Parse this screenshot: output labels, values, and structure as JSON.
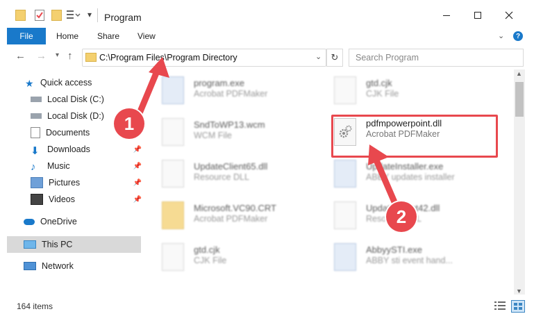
{
  "window": {
    "title": "Program"
  },
  "ribbon": {
    "tabs": [
      "File",
      "Home",
      "Share",
      "View"
    ]
  },
  "address": {
    "path": "C:\\Program Files\\Program Directory",
    "search_placeholder": "Search Program"
  },
  "nav": {
    "items": [
      {
        "label": "Quick access"
      },
      {
        "label": "Local Disk (C:)"
      },
      {
        "label": "Local Disk (D:)"
      },
      {
        "label": "Documents"
      },
      {
        "label": "Downloads"
      },
      {
        "label": "Music"
      },
      {
        "label": "Pictures"
      },
      {
        "label": "Videos"
      },
      {
        "label": "OneDrive"
      },
      {
        "label": "This PC"
      },
      {
        "label": "Network"
      }
    ]
  },
  "files": [
    {
      "name": "program.exe",
      "type": "Acrobat PDFMaker"
    },
    {
      "name": "gtd.cjk",
      "type": "CJK File"
    },
    {
      "name": "SndToWP13.wcm",
      "type": "WCM File"
    },
    {
      "name": "pdfmpowerpoint.dll",
      "type": "Acrobat PDFMaker"
    },
    {
      "name": "UpdateClient65.dll",
      "type": "Resource DLL"
    },
    {
      "name": "UpdateInstaller.exe",
      "type": "ABBY updates installer"
    },
    {
      "name": "Microsoft.VC90.CRT",
      "type": "Acrobat PDFMaker"
    },
    {
      "name": "UpdateClient42.dll",
      "type": "Resource DLL"
    },
    {
      "name": "gtd.cjk",
      "type": "CJK File"
    },
    {
      "name": "AbbyySTI.exe",
      "type": "ABBY sti event hand..."
    }
  ],
  "status": {
    "count": "164 items"
  },
  "annotations": {
    "step1": "1",
    "step2": "2"
  },
  "colors": {
    "accent": "#1979ca",
    "highlight": "#e8484e",
    "selection": "#d9d9d9"
  }
}
